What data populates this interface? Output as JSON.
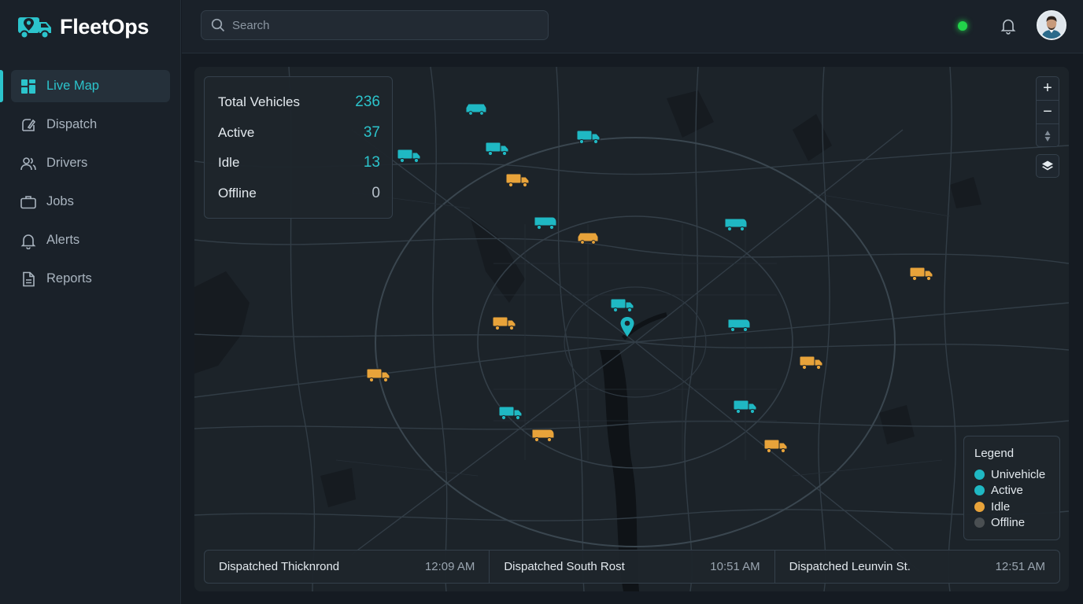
{
  "app": {
    "name": "FleetOps"
  },
  "sidebar": {
    "items": [
      {
        "label": "Live Map",
        "icon": "grid-icon",
        "active": true
      },
      {
        "label": "Dispatch",
        "icon": "dispatch-icon",
        "active": false
      },
      {
        "label": "Drivers",
        "icon": "users-icon",
        "active": false
      },
      {
        "label": "Jobs",
        "icon": "briefcase-icon",
        "active": false
      },
      {
        "label": "Alerts",
        "icon": "bell-icon",
        "active": false
      },
      {
        "label": "Reports",
        "icon": "document-icon",
        "active": false
      }
    ]
  },
  "search": {
    "placeholder": "Search",
    "value": ""
  },
  "header": {
    "status": "online",
    "status_color": "#22d44a"
  },
  "stats": {
    "total": {
      "label": "Total Vehicles",
      "value": "236"
    },
    "active": {
      "label": "Active",
      "value": "37"
    },
    "idle": {
      "label": "Idle",
      "value": "13"
    },
    "offline": {
      "label": "Offline",
      "value": "0"
    }
  },
  "map_controls": {
    "zoom_in": "+",
    "zoom_out": "−"
  },
  "legend": {
    "title": "Legend",
    "items": [
      {
        "label": "Univehicle",
        "color": "#1fb8c3"
      },
      {
        "label": "Active",
        "color": "#1fb8c3"
      },
      {
        "label": "Idle",
        "color": "#e8a33a"
      },
      {
        "label": "Offline",
        "color": "#4a4f52"
      }
    ]
  },
  "dispatch_feed": [
    {
      "text": "Dispatched Thicknrond",
      "time": "12:09 AM"
    },
    {
      "text": "Dispatched South Rost",
      "time": "10:51 AM"
    },
    {
      "text": "Dispatched Leunvin St.",
      "time": "12:51 AM"
    }
  ],
  "colors": {
    "accent": "#2cc4cc",
    "active_vehicle": "#1fb8c3",
    "idle_vehicle": "#e8a33a"
  },
  "vehicles": [
    {
      "kind": "car",
      "status": "active"
    },
    {
      "kind": "truck",
      "status": "active"
    },
    {
      "kind": "truck",
      "status": "active"
    },
    {
      "kind": "truck",
      "status": "active"
    },
    {
      "kind": "truck",
      "status": "idle"
    },
    {
      "kind": "van",
      "status": "active"
    },
    {
      "kind": "car",
      "status": "idle"
    },
    {
      "kind": "van",
      "status": "active"
    },
    {
      "kind": "truck",
      "status": "idle"
    },
    {
      "kind": "truck",
      "status": "active"
    },
    {
      "kind": "pin",
      "status": "active"
    },
    {
      "kind": "truck",
      "status": "idle"
    },
    {
      "kind": "van",
      "status": "active"
    },
    {
      "kind": "truck",
      "status": "idle"
    },
    {
      "kind": "truck",
      "status": "idle"
    },
    {
      "kind": "truck",
      "status": "active"
    },
    {
      "kind": "truck",
      "status": "active"
    },
    {
      "kind": "van",
      "status": "idle"
    },
    {
      "kind": "truck",
      "status": "idle"
    }
  ]
}
